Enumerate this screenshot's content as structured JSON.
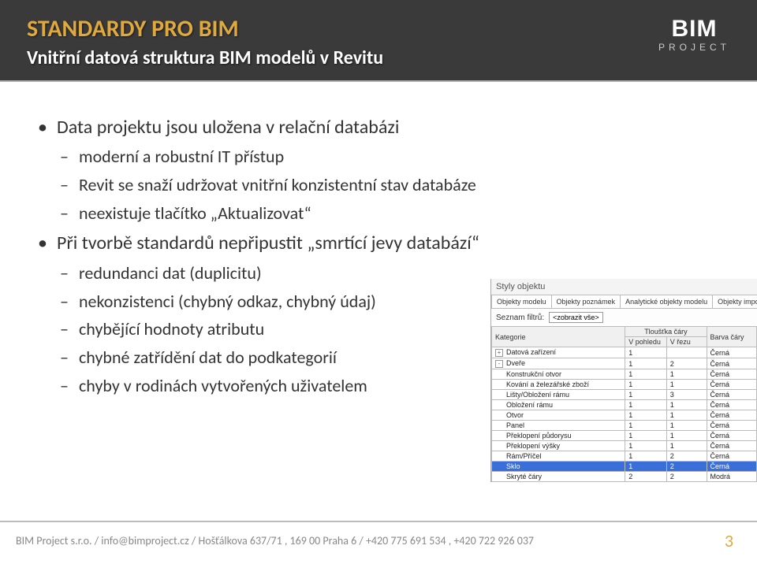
{
  "header": {
    "title": "STANDARDY PRO BIM",
    "subtitle": "Vnitřní datová struktura BIM modelů v Revitu"
  },
  "logo": {
    "top": "BIM",
    "bottom": "PROJECT"
  },
  "bullets": [
    {
      "text": "Data projektu jsou uložena v relační databázi",
      "children": [
        "moderní a robustní IT přístup",
        "Revit se snaží udržovat vnitřní konzistentní stav databáze",
        "neexistuje tlačítko „Aktualizovat“"
      ]
    },
    {
      "text": "Při tvorbě standardů nepřipustit „smrtící jevy databází“",
      "children": [
        "redundanci dat (duplicitu)",
        "nekonzistenci (chybný odkaz, chybný údaj)",
        "chybějící hodnoty atributu",
        "chybné zatřídění dat do podkategorií",
        "chyby v rodinách vytvořených uživatelem"
      ]
    }
  ],
  "screenshot": {
    "windowTitle": "Styly objektu",
    "tabs": [
      "Objekty modelu",
      "Objekty poznámek",
      "Analytické objekty modelu",
      "Objekty importová"
    ],
    "filterLabel": "Seznam filtrů:",
    "filterValue": "<zobrazit vše>",
    "headerTop": {
      "thick": "Tloušťka čáry"
    },
    "headerBottom": {
      "cat": "Kategorie",
      "view": "V pohledu",
      "cut": "V řezu",
      "color": "Barva čáry"
    },
    "rows": [
      {
        "cat": "Datová zařízení",
        "v": "1",
        "r": "",
        "color": "Černá",
        "tree": "+",
        "indent": 0
      },
      {
        "cat": "Dveře",
        "v": "1",
        "r": "2",
        "color": "Černá",
        "tree": "-",
        "indent": 0
      },
      {
        "cat": "Konstrukční otvor",
        "v": "1",
        "r": "1",
        "color": "Černá",
        "tree": "",
        "indent": 1
      },
      {
        "cat": "Kování a železářské zboží",
        "v": "1",
        "r": "1",
        "color": "Černá",
        "tree": "",
        "indent": 1
      },
      {
        "cat": "Lišty/Obložení rámu",
        "v": "1",
        "r": "3",
        "color": "Černá",
        "tree": "",
        "indent": 1
      },
      {
        "cat": "Obložení rámu",
        "v": "1",
        "r": "1",
        "color": "Černá",
        "tree": "",
        "indent": 1
      },
      {
        "cat": "Otvor",
        "v": "1",
        "r": "1",
        "color": "Černá",
        "tree": "",
        "indent": 1
      },
      {
        "cat": "Panel",
        "v": "1",
        "r": "1",
        "color": "Černá",
        "tree": "",
        "indent": 1
      },
      {
        "cat": "Překlopení půdorysu",
        "v": "1",
        "r": "1",
        "color": "Černá",
        "tree": "",
        "indent": 1
      },
      {
        "cat": "Překlopení výšky",
        "v": "1",
        "r": "1",
        "color": "Černá",
        "tree": "",
        "indent": 1
      },
      {
        "cat": "Rám/Příčel",
        "v": "1",
        "r": "2",
        "color": "Černá",
        "tree": "",
        "indent": 1
      },
      {
        "cat": "Sklo",
        "v": "1",
        "r": "2",
        "color": "Černá",
        "tree": "",
        "indent": 1,
        "sel": true
      },
      {
        "cat": "Skryté čáry",
        "v": "2",
        "r": "2",
        "color": "Modrá",
        "tree": "",
        "indent": 1
      }
    ]
  },
  "footer": {
    "text": "BIM Project s.r.o.  /  info@bimproject.cz  /  Hošťálkova 637/71 , 169 00 Praha 6  /  +420 775 691 534 , +420 722 926 037",
    "page": "3"
  }
}
